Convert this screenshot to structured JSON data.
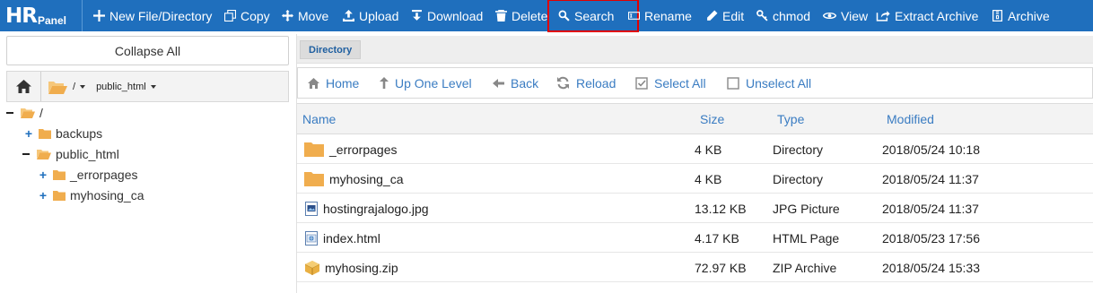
{
  "brand": {
    "hr": "HR",
    "panel": "Panel"
  },
  "toolbar": {
    "new_file": "New File/Directory",
    "copy": "Copy",
    "move": "Move",
    "upload": "Upload",
    "download": "Download",
    "delete": "Delete",
    "search": "Search",
    "rename": "Rename",
    "edit": "Edit",
    "chmod": "chmod",
    "view": "View",
    "extract": "Extract Archive",
    "archive": "Archive"
  },
  "sidebar": {
    "collapse_all": "Collapse All",
    "path": {
      "root": "/",
      "current": "public_html"
    },
    "tree": {
      "root": "/",
      "backups": "backups",
      "public_html": "public_html",
      "errorpages": "_errorpages",
      "myhosing_ca": "myhosing_ca"
    }
  },
  "main": {
    "tab": "Directory",
    "nav": {
      "home": "Home",
      "up": "Up One Level",
      "back": "Back",
      "reload": "Reload",
      "select_all": "Select All",
      "unselect_all": "Unselect All"
    },
    "columns": {
      "name": "Name",
      "size": "Size",
      "type": "Type",
      "modified": "Modified"
    },
    "files": [
      {
        "name": "_errorpages",
        "size": "4 KB",
        "type": "Directory",
        "modified": "2018/05/24 10:18",
        "icon": "folder-icon"
      },
      {
        "name": "myhosing_ca",
        "size": "4 KB",
        "type": "Directory",
        "modified": "2018/05/24 11:37",
        "icon": "folder-icon"
      },
      {
        "name": "hostingrajalogo.jpg",
        "size": "13.12 KB",
        "type": "JPG Picture",
        "modified": "2018/05/24 11:37",
        "icon": "image-file-icon"
      },
      {
        "name": "index.html",
        "size": "4.17 KB",
        "type": "HTML Page",
        "modified": "2018/05/23 17:56",
        "icon": "html-file-icon"
      },
      {
        "name": "myhosing.zip",
        "size": "72.97 KB",
        "type": "ZIP Archive",
        "modified": "2018/05/24 15:33",
        "icon": "zip-file-icon"
      }
    ]
  },
  "colors": {
    "topbar": "#1f6fbd",
    "link": "#3a7cc2",
    "folder": "#f0ad4e",
    "highlight": "#e00000"
  }
}
